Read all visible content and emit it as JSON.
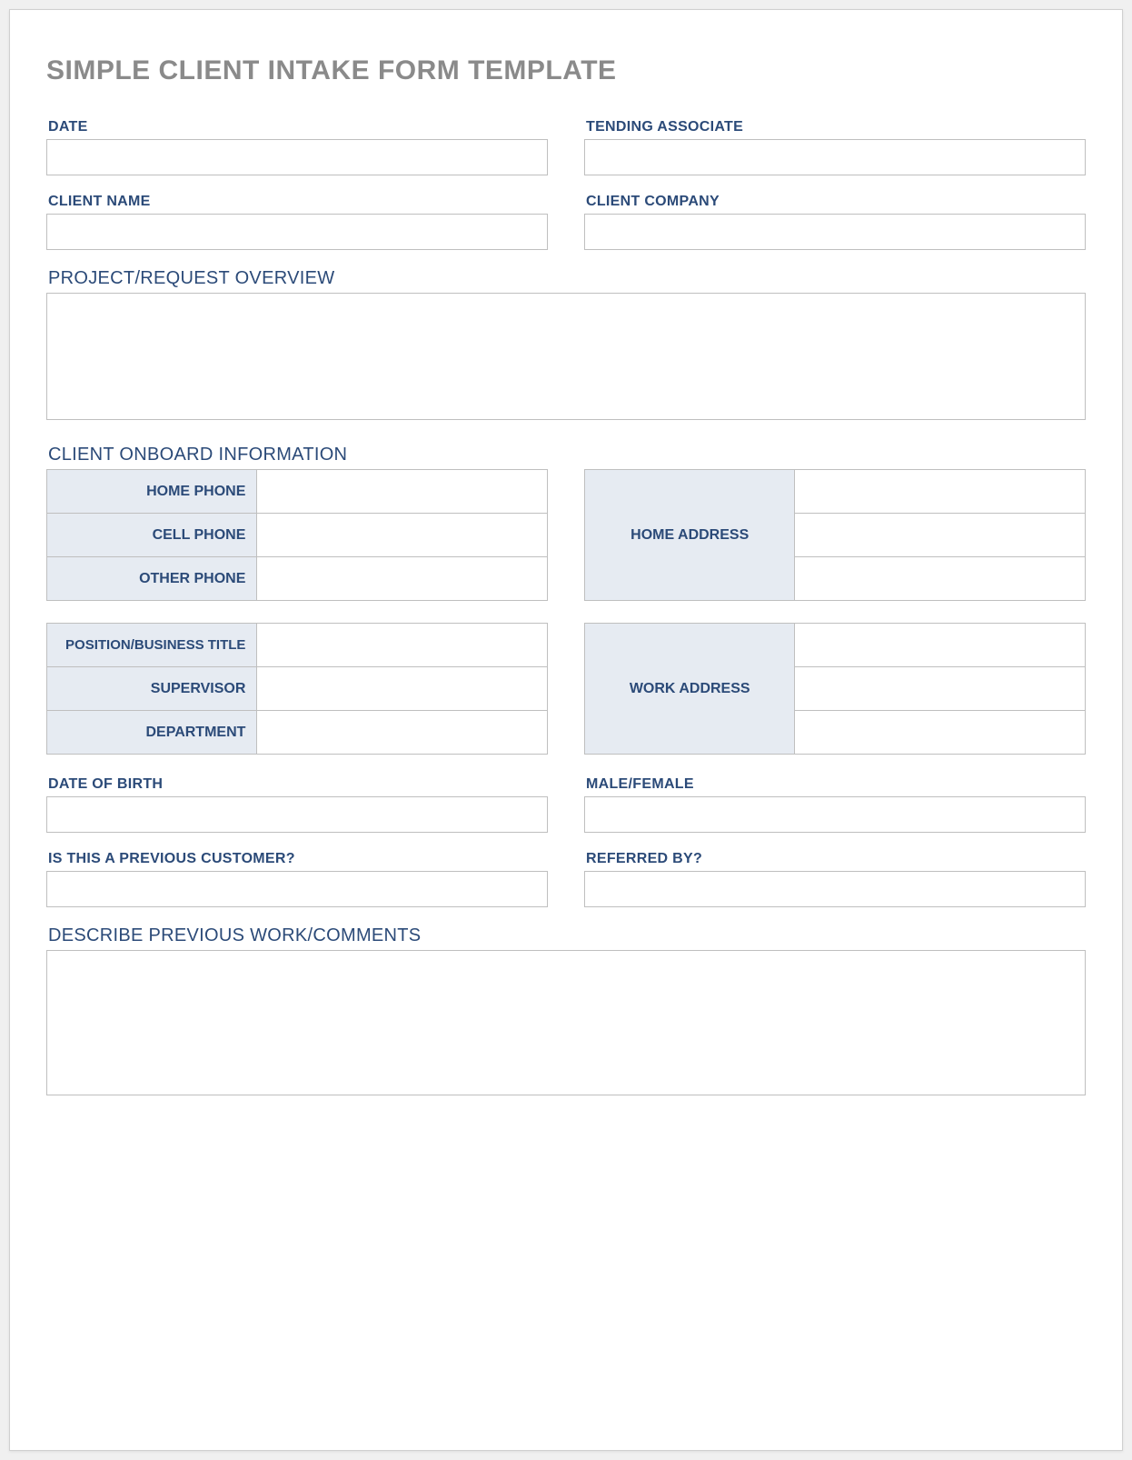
{
  "title": "SIMPLE CLIENT INTAKE FORM TEMPLATE",
  "top": {
    "date_label": "DATE",
    "date_value": "",
    "associate_label": "TENDING ASSOCIATE",
    "associate_value": "",
    "client_name_label": "CLIENT NAME",
    "client_name_value": "",
    "client_company_label": "CLIENT COMPANY",
    "client_company_value": ""
  },
  "overview": {
    "label": "PROJECT/REQUEST OVERVIEW",
    "value": ""
  },
  "onboard": {
    "label": "CLIENT ONBOARD INFORMATION",
    "home_phone_label": "HOME PHONE",
    "home_phone_value": "",
    "cell_phone_label": "CELL PHONE",
    "cell_phone_value": "",
    "other_phone_label": "OTHER PHONE",
    "other_phone_value": "",
    "home_address_label": "HOME ADDRESS",
    "home_address_1": "",
    "home_address_2": "",
    "home_address_3": "",
    "position_label": "POSITION/BUSINESS TITLE",
    "position_value": "",
    "supervisor_label": "SUPERVISOR",
    "supervisor_value": "",
    "department_label": "DEPARTMENT",
    "department_value": "",
    "work_address_label": "WORK ADDRESS",
    "work_address_1": "",
    "work_address_2": "",
    "work_address_3": ""
  },
  "details": {
    "dob_label": "DATE OF BIRTH",
    "dob_value": "",
    "gender_label": "MALE/FEMALE",
    "gender_value": "",
    "prev_customer_label": "IS THIS A PREVIOUS CUSTOMER?",
    "prev_customer_value": "",
    "referred_label": "REFERRED BY?",
    "referred_value": ""
  },
  "comments": {
    "label": "DESCRIBE PREVIOUS WORK/COMMENTS",
    "value": ""
  }
}
